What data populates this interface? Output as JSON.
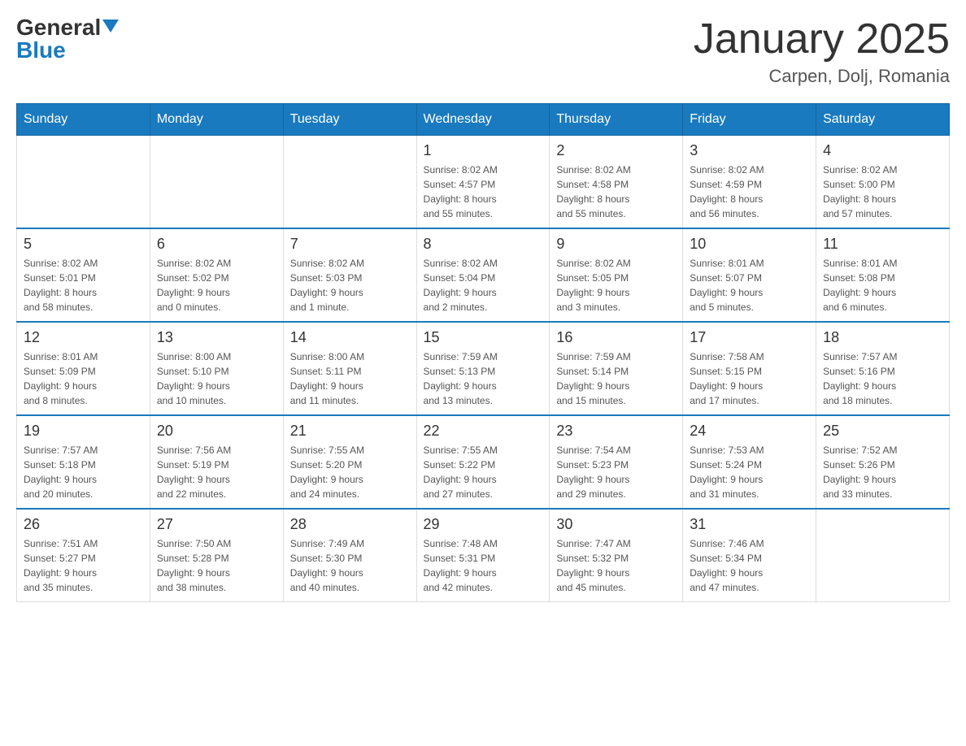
{
  "header": {
    "logo_general": "General",
    "logo_blue": "Blue",
    "month_title": "January 2025",
    "location": "Carpen, Dolj, Romania"
  },
  "days_of_week": [
    "Sunday",
    "Monday",
    "Tuesday",
    "Wednesday",
    "Thursday",
    "Friday",
    "Saturday"
  ],
  "weeks": [
    [
      {
        "day": "",
        "info": ""
      },
      {
        "day": "",
        "info": ""
      },
      {
        "day": "",
        "info": ""
      },
      {
        "day": "1",
        "info": "Sunrise: 8:02 AM\nSunset: 4:57 PM\nDaylight: 8 hours\nand 55 minutes."
      },
      {
        "day": "2",
        "info": "Sunrise: 8:02 AM\nSunset: 4:58 PM\nDaylight: 8 hours\nand 55 minutes."
      },
      {
        "day": "3",
        "info": "Sunrise: 8:02 AM\nSunset: 4:59 PM\nDaylight: 8 hours\nand 56 minutes."
      },
      {
        "day": "4",
        "info": "Sunrise: 8:02 AM\nSunset: 5:00 PM\nDaylight: 8 hours\nand 57 minutes."
      }
    ],
    [
      {
        "day": "5",
        "info": "Sunrise: 8:02 AM\nSunset: 5:01 PM\nDaylight: 8 hours\nand 58 minutes."
      },
      {
        "day": "6",
        "info": "Sunrise: 8:02 AM\nSunset: 5:02 PM\nDaylight: 9 hours\nand 0 minutes."
      },
      {
        "day": "7",
        "info": "Sunrise: 8:02 AM\nSunset: 5:03 PM\nDaylight: 9 hours\nand 1 minute."
      },
      {
        "day": "8",
        "info": "Sunrise: 8:02 AM\nSunset: 5:04 PM\nDaylight: 9 hours\nand 2 minutes."
      },
      {
        "day": "9",
        "info": "Sunrise: 8:02 AM\nSunset: 5:05 PM\nDaylight: 9 hours\nand 3 minutes."
      },
      {
        "day": "10",
        "info": "Sunrise: 8:01 AM\nSunset: 5:07 PM\nDaylight: 9 hours\nand 5 minutes."
      },
      {
        "day": "11",
        "info": "Sunrise: 8:01 AM\nSunset: 5:08 PM\nDaylight: 9 hours\nand 6 minutes."
      }
    ],
    [
      {
        "day": "12",
        "info": "Sunrise: 8:01 AM\nSunset: 5:09 PM\nDaylight: 9 hours\nand 8 minutes."
      },
      {
        "day": "13",
        "info": "Sunrise: 8:00 AM\nSunset: 5:10 PM\nDaylight: 9 hours\nand 10 minutes."
      },
      {
        "day": "14",
        "info": "Sunrise: 8:00 AM\nSunset: 5:11 PM\nDaylight: 9 hours\nand 11 minutes."
      },
      {
        "day": "15",
        "info": "Sunrise: 7:59 AM\nSunset: 5:13 PM\nDaylight: 9 hours\nand 13 minutes."
      },
      {
        "day": "16",
        "info": "Sunrise: 7:59 AM\nSunset: 5:14 PM\nDaylight: 9 hours\nand 15 minutes."
      },
      {
        "day": "17",
        "info": "Sunrise: 7:58 AM\nSunset: 5:15 PM\nDaylight: 9 hours\nand 17 minutes."
      },
      {
        "day": "18",
        "info": "Sunrise: 7:57 AM\nSunset: 5:16 PM\nDaylight: 9 hours\nand 18 minutes."
      }
    ],
    [
      {
        "day": "19",
        "info": "Sunrise: 7:57 AM\nSunset: 5:18 PM\nDaylight: 9 hours\nand 20 minutes."
      },
      {
        "day": "20",
        "info": "Sunrise: 7:56 AM\nSunset: 5:19 PM\nDaylight: 9 hours\nand 22 minutes."
      },
      {
        "day": "21",
        "info": "Sunrise: 7:55 AM\nSunset: 5:20 PM\nDaylight: 9 hours\nand 24 minutes."
      },
      {
        "day": "22",
        "info": "Sunrise: 7:55 AM\nSunset: 5:22 PM\nDaylight: 9 hours\nand 27 minutes."
      },
      {
        "day": "23",
        "info": "Sunrise: 7:54 AM\nSunset: 5:23 PM\nDaylight: 9 hours\nand 29 minutes."
      },
      {
        "day": "24",
        "info": "Sunrise: 7:53 AM\nSunset: 5:24 PM\nDaylight: 9 hours\nand 31 minutes."
      },
      {
        "day": "25",
        "info": "Sunrise: 7:52 AM\nSunset: 5:26 PM\nDaylight: 9 hours\nand 33 minutes."
      }
    ],
    [
      {
        "day": "26",
        "info": "Sunrise: 7:51 AM\nSunset: 5:27 PM\nDaylight: 9 hours\nand 35 minutes."
      },
      {
        "day": "27",
        "info": "Sunrise: 7:50 AM\nSunset: 5:28 PM\nDaylight: 9 hours\nand 38 minutes."
      },
      {
        "day": "28",
        "info": "Sunrise: 7:49 AM\nSunset: 5:30 PM\nDaylight: 9 hours\nand 40 minutes."
      },
      {
        "day": "29",
        "info": "Sunrise: 7:48 AM\nSunset: 5:31 PM\nDaylight: 9 hours\nand 42 minutes."
      },
      {
        "day": "30",
        "info": "Sunrise: 7:47 AM\nSunset: 5:32 PM\nDaylight: 9 hours\nand 45 minutes."
      },
      {
        "day": "31",
        "info": "Sunrise: 7:46 AM\nSunset: 5:34 PM\nDaylight: 9 hours\nand 47 minutes."
      },
      {
        "day": "",
        "info": ""
      }
    ]
  ]
}
